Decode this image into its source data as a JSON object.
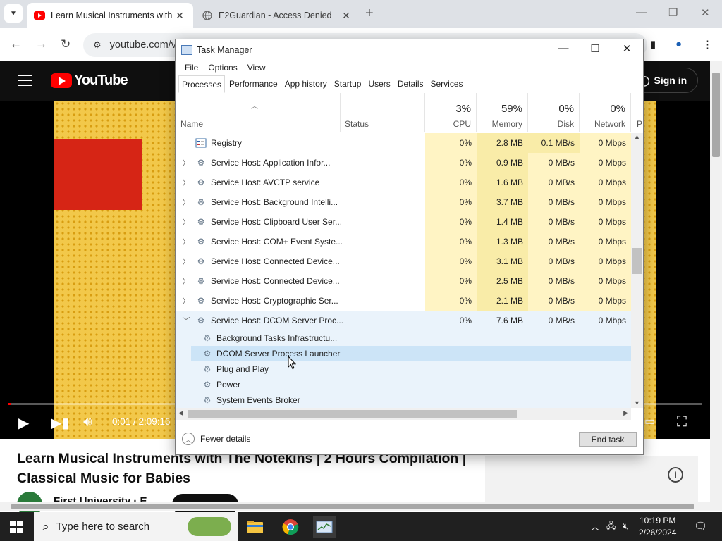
{
  "browser": {
    "tabs": [
      {
        "title": "Learn Musical Instruments with",
        "active": true
      },
      {
        "title": "E2Guardian - Access Denied",
        "active": false
      }
    ],
    "url": "youtube.com/v"
  },
  "youtube": {
    "sign_in": "Sign in",
    "video_time": "0:01 / 2:09:16",
    "video_progress": 0.003,
    "title": "Learn Musical Instruments with The Notekins | 2 Hours Compilation | Classical Music for Babies",
    "channel": "First University · E",
    "info_icon": "i"
  },
  "taskmanager": {
    "title": "Task Manager",
    "menu": [
      "File",
      "Options",
      "View"
    ],
    "tabs": [
      "Processes",
      "Performance",
      "App history",
      "Startup",
      "Users",
      "Details",
      "Services"
    ],
    "active_tab": "Processes",
    "headers": {
      "name": "Name",
      "status": "Status",
      "cpu_pct": "3%",
      "cpu": "CPU",
      "mem_pct": "59%",
      "mem": "Memory",
      "disk_pct": "0%",
      "disk": "Disk",
      "net_pct": "0%",
      "net": "Network",
      "extra": "P"
    },
    "rows": [
      {
        "name": "Registry",
        "cpu": "0%",
        "mem": "2.8 MB",
        "disk": "0.1 MB/s",
        "net": "0 Mbps",
        "expandable": false
      },
      {
        "name": "Service Host: Application Infor...",
        "cpu": "0%",
        "mem": "0.9 MB",
        "disk": "0 MB/s",
        "net": "0 Mbps",
        "expandable": true
      },
      {
        "name": "Service Host: AVCTP service",
        "cpu": "0%",
        "mem": "1.6 MB",
        "disk": "0 MB/s",
        "net": "0 Mbps",
        "expandable": true
      },
      {
        "name": "Service Host: Background Intelli...",
        "cpu": "0%",
        "mem": "3.7 MB",
        "disk": "0 MB/s",
        "net": "0 Mbps",
        "expandable": true
      },
      {
        "name": "Service Host: Clipboard User Ser...",
        "cpu": "0%",
        "mem": "1.4 MB",
        "disk": "0 MB/s",
        "net": "0 Mbps",
        "expandable": true
      },
      {
        "name": "Service Host: COM+ Event Syste...",
        "cpu": "0%",
        "mem": "1.3 MB",
        "disk": "0 MB/s",
        "net": "0 Mbps",
        "expandable": true
      },
      {
        "name": "Service Host: Connected Device...",
        "cpu": "0%",
        "mem": "3.1 MB",
        "disk": "0 MB/s",
        "net": "0 Mbps",
        "expandable": true
      },
      {
        "name": "Service Host: Connected Device...",
        "cpu": "0%",
        "mem": "2.5 MB",
        "disk": "0 MB/s",
        "net": "0 Mbps",
        "expandable": true
      },
      {
        "name": "Service Host: Cryptographic Ser...",
        "cpu": "0%",
        "mem": "2.1 MB",
        "disk": "0 MB/s",
        "net": "0 Mbps",
        "expandable": true
      },
      {
        "name": "Service Host: DCOM Server Proc...",
        "cpu": "0%",
        "mem": "7.6 MB",
        "disk": "0 MB/s",
        "net": "0 Mbps",
        "expandable": true,
        "expanded": true
      }
    ],
    "children": [
      {
        "name": "Background Tasks Infrastructu...",
        "selected": false
      },
      {
        "name": "DCOM Server Process Launcher",
        "selected": true
      },
      {
        "name": "Plug and Play",
        "selected": false
      },
      {
        "name": "Power",
        "selected": false
      },
      {
        "name": "System Events Broker",
        "selected": false
      }
    ],
    "fewer_details": "Fewer details",
    "end_task": "End task"
  },
  "taskbar": {
    "search_placeholder": "Type here to search",
    "time": "10:19 PM",
    "date": "2/26/2024"
  }
}
